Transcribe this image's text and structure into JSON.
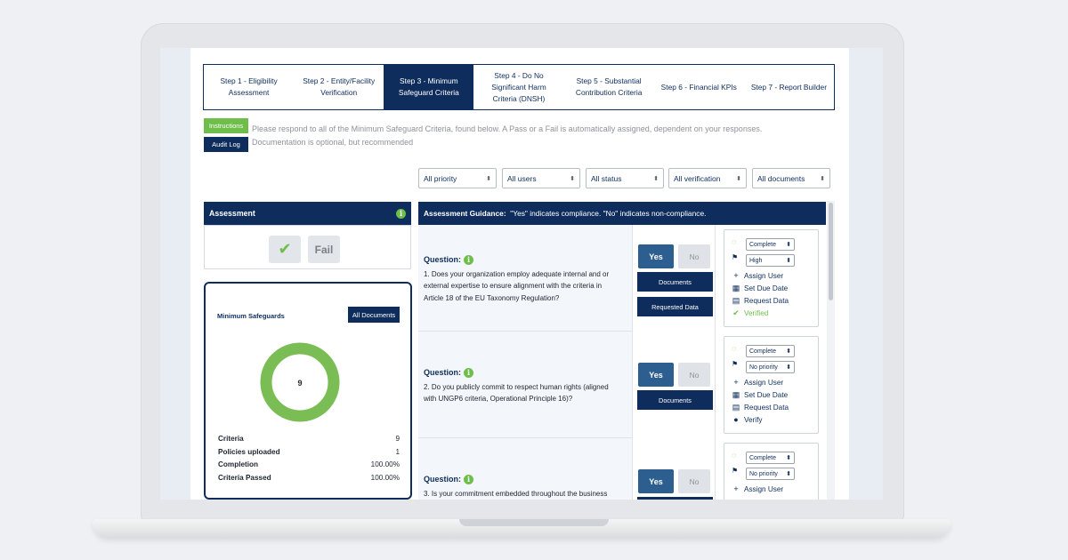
{
  "steps": [
    {
      "line1": "Step 1 - Eligibility",
      "line2": "Assessment",
      "line3": "",
      "active": false
    },
    {
      "line1": "Step 2 - Entity/Facility",
      "line2": "Verification",
      "line3": "",
      "active": false
    },
    {
      "line1": "Step 3 - Minimum",
      "line2": "Safeguard Criteria",
      "line3": "",
      "active": true
    },
    {
      "line1": "Step 4 - Do No",
      "line2": "Significant Harm",
      "line3": "Criteria (DNSH)",
      "active": false
    },
    {
      "line1": "Step 5 - Substantial",
      "line2": "Contribution Criteria",
      "line3": "",
      "active": false
    },
    {
      "line1": "Step 6 - Financial KPIs",
      "line2": "",
      "line3": "",
      "active": false
    },
    {
      "line1": "Step 7 - Report Builder",
      "line2": "",
      "line3": "",
      "active": false
    }
  ],
  "toolbar": {
    "instructions_label": "Instructions",
    "audit_label": "Audit Log",
    "note_line1": "Please respond to all of the Minimum Safeguard Criteria, found below. A Pass or a Fail is automatically assigned, dependent on your responses.",
    "note_line2": "Documentation is optional, but recommended"
  },
  "filters": [
    "All priority",
    "All users",
    "All status",
    "All verification",
    "All documents"
  ],
  "assessment": {
    "title": "Assessment",
    "info": "i",
    "check": "✔",
    "fail_label": "Fail"
  },
  "summary": {
    "title": "Minimum Safeguards",
    "all_docs_label": "All Documents",
    "donut_value": "9",
    "stats": [
      {
        "label": "Criteria",
        "value": "9"
      },
      {
        "label": "Policies uploaded",
        "value": "1"
      },
      {
        "label": "Completion",
        "value": "100.00%"
      },
      {
        "label": "Criteria Passed",
        "value": "100.00%"
      }
    ],
    "donut_fraction": 1.0,
    "colors": {
      "donut": "#7bbd55",
      "navy": "#0e2d5c",
      "green": "#6fbe4b"
    }
  },
  "guidance": {
    "label": "Assessment Guidance:",
    "text": "\"Yes\" indicates compliance. \"No\" indicates non-compliance."
  },
  "questions": [
    {
      "label": "Question:",
      "line1": "1. Does your organization employ adequate internal and or",
      "line2": "external expertise to ensure alignment with the criteria in",
      "line3": "Article 18 of the EU Taxonomy Regulation?",
      "yes": "Yes",
      "no": "No",
      "btn1": "Documents",
      "btn2": "Requested Data",
      "status": "Complete",
      "priority": "High",
      "assign": "Assign User",
      "due": "Set Due Date",
      "request": "Request Data",
      "verify": "Verified"
    },
    {
      "label": "Question:",
      "line1": "2. Do you publicly commit to respect human rights (aligned",
      "line2": "with UNGP6 criteria, Operational Principle 16)?",
      "line3": "",
      "yes": "Yes",
      "no": "No",
      "btn1": "Documents",
      "btn2": "",
      "status": "Complete",
      "priority": "No priority",
      "assign": "Assign User",
      "due": "Set Due Date",
      "request": "Request Data",
      "verify": "Verify"
    },
    {
      "label": "Question:",
      "line1": "3. Is your commitment embedded throughout the business",
      "line2": "",
      "line3": "",
      "yes": "Yes",
      "no": "No",
      "btn1": "",
      "btn2": "",
      "status": "Complete",
      "priority": "No priority",
      "assign": "Assign User",
      "due": "",
      "request": "",
      "verify": ""
    }
  ]
}
